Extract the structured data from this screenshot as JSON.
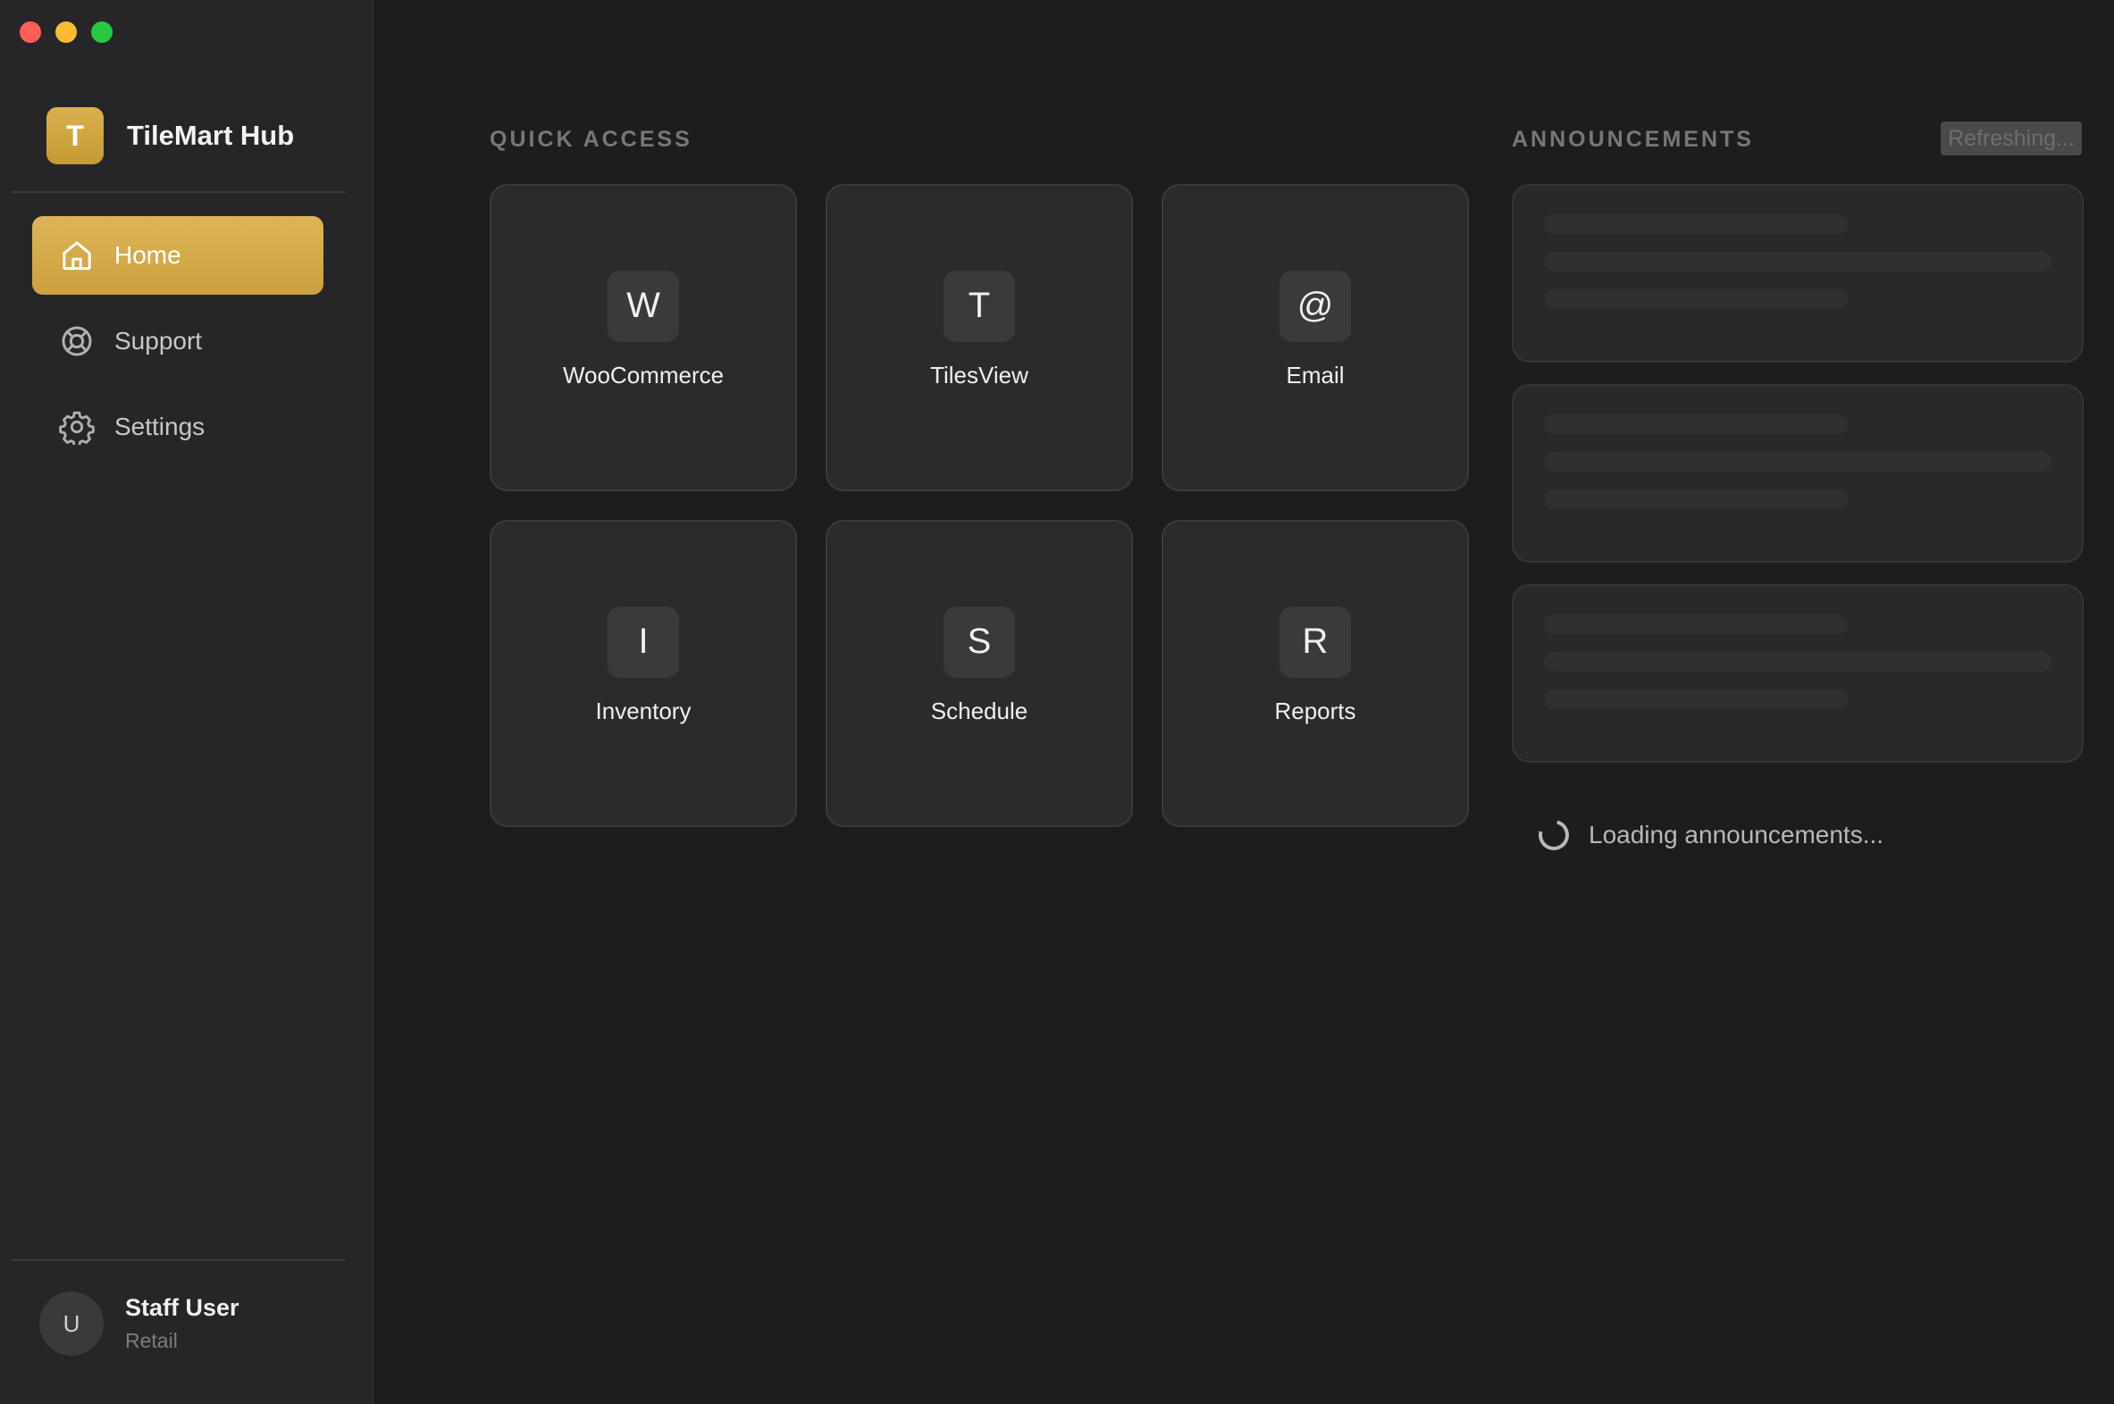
{
  "app": {
    "brand_initial": "T",
    "brand_name": "TileMart Hub"
  },
  "window_controls": {
    "close_color": "#ff5f57",
    "minimize_color": "#febc2e",
    "zoom_color": "#28c840"
  },
  "sidebar": {
    "items": [
      {
        "label": "Home",
        "icon": "home-icon",
        "active": true
      },
      {
        "label": "Support",
        "icon": "lifebuoy-icon",
        "active": false
      },
      {
        "label": "Settings",
        "icon": "gear-icon",
        "active": false
      }
    ],
    "user": {
      "initial": "U",
      "name": "Staff User",
      "role": "Retail"
    }
  },
  "quick_access": {
    "title": "QUICK ACCESS",
    "tiles": [
      {
        "glyph": "W",
        "label": "WooCommerce"
      },
      {
        "glyph": "T",
        "label": "TilesView"
      },
      {
        "glyph": "@",
        "label": "Email"
      },
      {
        "glyph": "I",
        "label": "Inventory"
      },
      {
        "glyph": "S",
        "label": "Schedule"
      },
      {
        "glyph": "R",
        "label": "Reports"
      }
    ]
  },
  "announcements": {
    "title": "ANNOUNCEMENTS",
    "refresh_label": "Refreshing...",
    "loading_text": "Loading announcements..."
  },
  "colors": {
    "accent": "#d4aa4a",
    "background": "#1d1d1f",
    "sidebar": "#262628"
  }
}
